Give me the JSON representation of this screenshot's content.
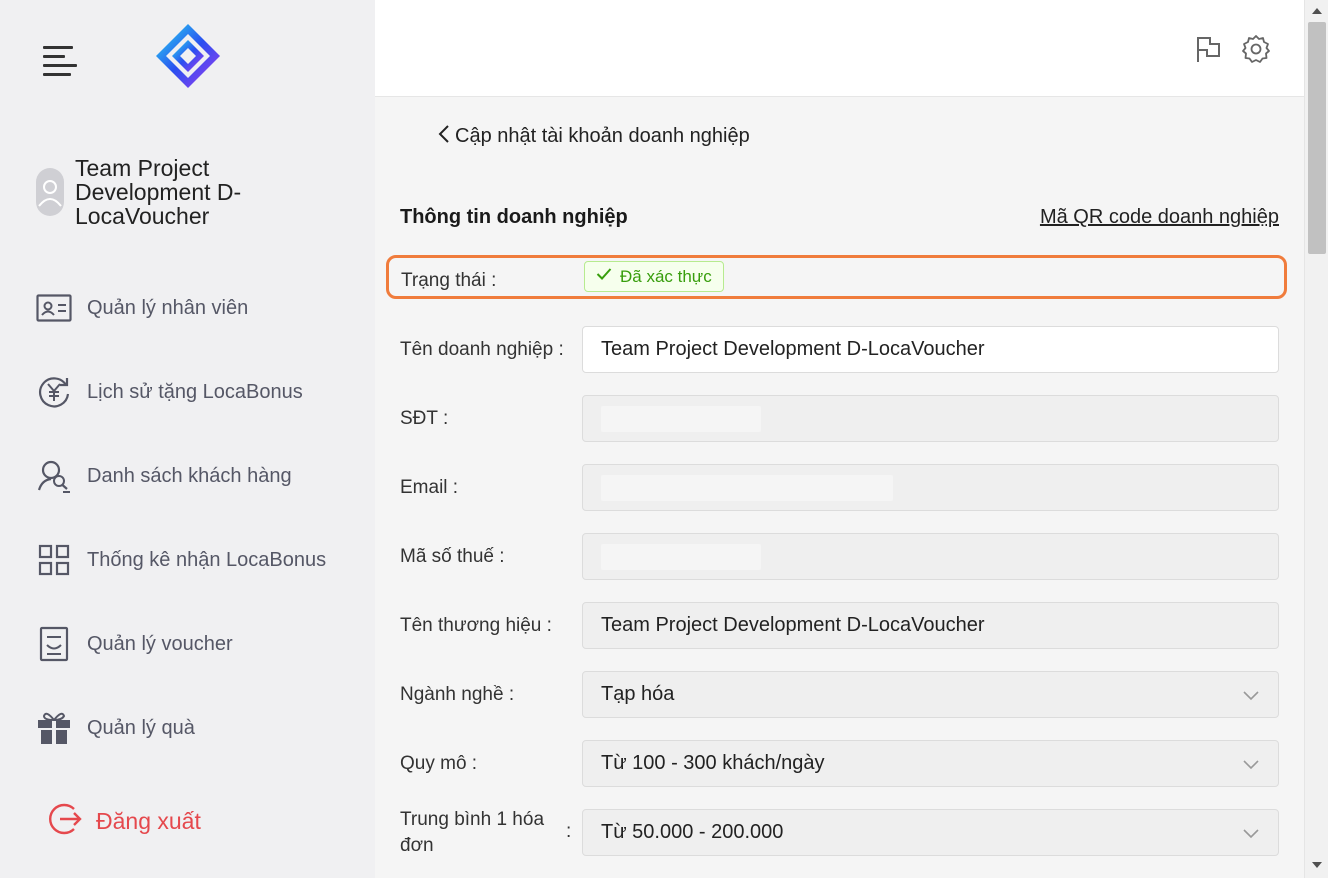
{
  "sidebar": {
    "profile_name": "Team Project Development D-LocaVoucher",
    "items": [
      {
        "label": "Quản lý nhân viên",
        "icon": "id-card-icon"
      },
      {
        "label": "Lịch sử tặng LocaBonus",
        "icon": "yen-history-icon"
      },
      {
        "label": "Danh sách khách hàng",
        "icon": "customer-search-icon"
      },
      {
        "label": "Thống kê nhận LocaBonus",
        "icon": "grid-icon"
      },
      {
        "label": "Quản lý voucher",
        "icon": "voucher-icon"
      },
      {
        "label": "Quản lý quà",
        "icon": "gift-icon"
      }
    ],
    "logout_label": "Đăng xuất"
  },
  "header": {
    "icons": [
      "flag-icon",
      "gear-icon"
    ]
  },
  "page": {
    "back_label": "Cập nhật tài khoản doanh nghiệp",
    "section_title": "Thông tin doanh nghiệp",
    "qr_link": "Mã QR code doanh nghiệp",
    "status": {
      "label": "Trạng thái",
      "badge": "Đã xác thực"
    },
    "fields": {
      "business_name": {
        "label": "Tên doanh nghiệp",
        "value": "Team Project Development D-LocaVoucher"
      },
      "phone": {
        "label": "SĐT",
        "value": ""
      },
      "email": {
        "label": "Email",
        "value": ""
      },
      "tax_code": {
        "label": "Mã số thuế",
        "value": ""
      },
      "brand_name": {
        "label": "Tên thương hiệu",
        "value": "Team Project Development D-LocaVoucher"
      },
      "industry": {
        "label": "Ngành nghề",
        "value": "Tạp hóa"
      },
      "scale": {
        "label": "Quy mô",
        "value": "Từ 100 - 300 khách/ngày"
      },
      "avg_invoice": {
        "label": "Trung bình 1 hóa đơn",
        "value": "Từ 50.000 - 200.000"
      }
    }
  },
  "colors": {
    "accent_orange": "#f07c3c",
    "success_green": "#389e0d",
    "logout_red": "#e5484d"
  }
}
